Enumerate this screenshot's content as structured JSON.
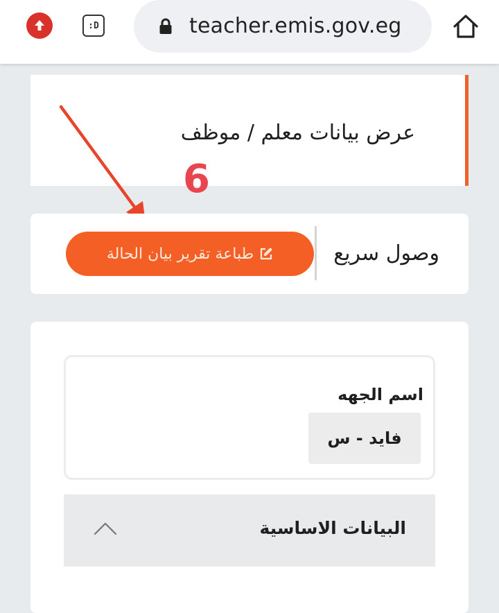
{
  "browser": {
    "url": "teacher.emis.gov.eg",
    "tab_icon_text": ":D",
    "icons": [
      "upload-icon",
      "tab-switcher-icon",
      "lock-icon",
      "home-icon"
    ]
  },
  "header": {
    "title": "عرض بيانات معلم / موظف"
  },
  "annotation": {
    "step_number": "6"
  },
  "quick_access": {
    "label": "وصول سريع",
    "print_button_label": "طباعة تقرير بيان الحالة",
    "print_button_icon": "edit-icon"
  },
  "entity": {
    "label": "اسم الجهه",
    "value": "فايد - س"
  },
  "section": {
    "title": "البيانات الاساسية",
    "toggle_icon": "chevron-up-icon"
  },
  "colors": {
    "accent": "#f35f24",
    "annotation": "#e8454f",
    "background": "#e8ebee"
  }
}
